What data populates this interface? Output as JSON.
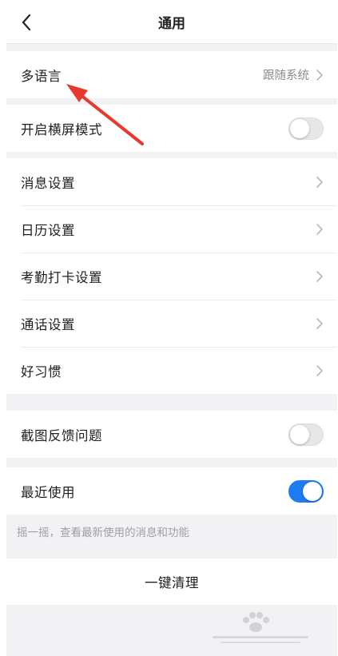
{
  "nav": {
    "title": "通用"
  },
  "language": {
    "label": "多语言",
    "value": "跟随系统"
  },
  "landscape": {
    "label": "开启横屏模式",
    "on": false
  },
  "settings_list": [
    {
      "label": "消息设置"
    },
    {
      "label": "日历设置"
    },
    {
      "label": "考勤打卡设置"
    },
    {
      "label": "通话设置"
    },
    {
      "label": "好习惯"
    }
  ],
  "screenshot_feedback": {
    "label": "截图反馈问题",
    "on": false
  },
  "recent_use": {
    "label": "最近使用",
    "on": true,
    "hint": "摇一摇，查看最新使用的消息和功能"
  },
  "clear": {
    "label": "一键清理"
  },
  "colors": {
    "accent": "#1e7cf2",
    "annotation": "#e8392d",
    "background": "#f2f2f4"
  }
}
